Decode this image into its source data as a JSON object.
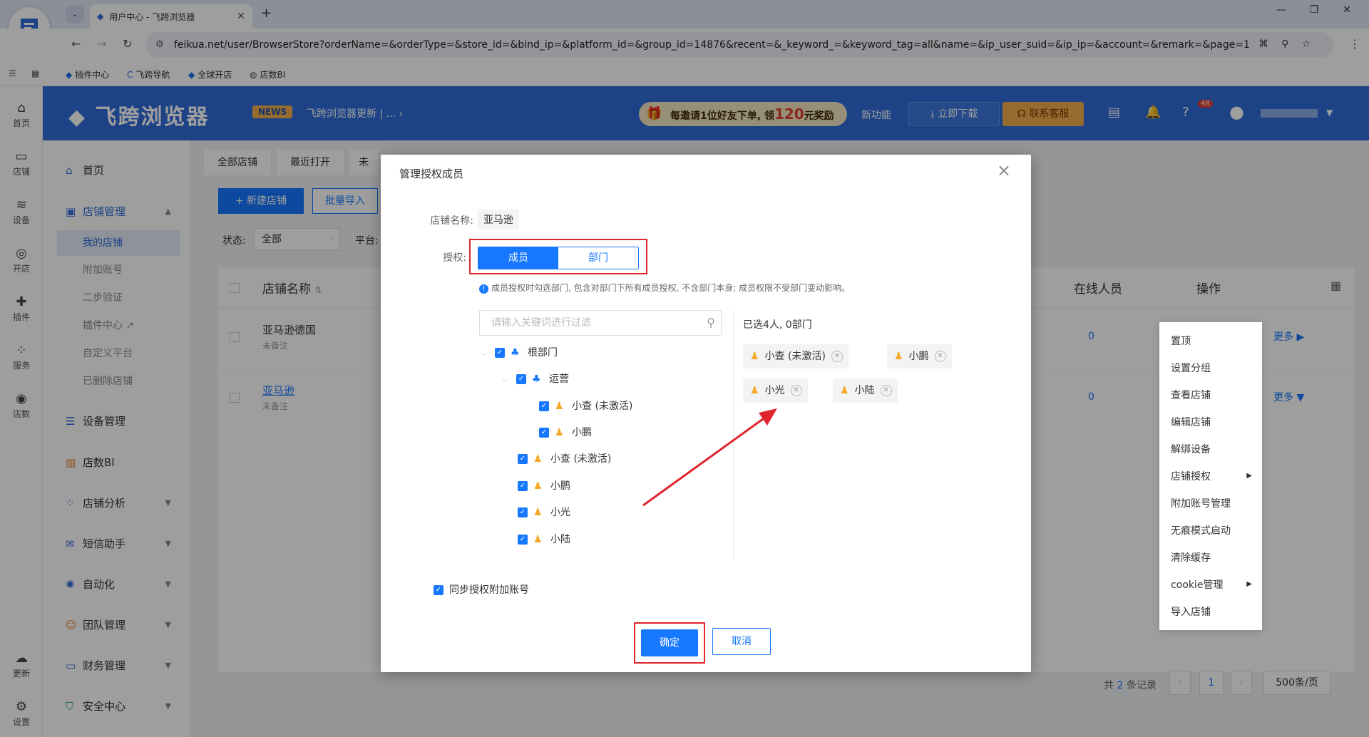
{
  "browser": {
    "tab_title": "用户中心 - 飞跨浏览器",
    "url": "feikua.net/user/BrowserStore?orderName=&orderType=&store_id=&bind_ip=&platform_id=&group_id=14876&recent=&_keyword_=&keyword_tag=all&name=&ip_user_suid=&ip_ip=&account=&remark=&page=1",
    "bookmarks": [
      "插件中心",
      "飞跨导航",
      "全球开店",
      "店数BI"
    ]
  },
  "rail": [
    "首页",
    "店铺",
    "设备",
    "开店",
    "插件",
    "服务",
    "店数",
    "更新",
    "设置"
  ],
  "header": {
    "logo": "飞跨浏览器",
    "news_badge": "NEWS",
    "news_text": "飞跨浏览器更新 | ...",
    "promo_pre": "每邀请1位好友下单, 领",
    "promo_amount": "120",
    "promo_post": "元奖励",
    "new_features": "新功能",
    "download": "立即下载",
    "contact": "联系客服",
    "bell_count": "48"
  },
  "sidebar": {
    "home": "首页",
    "store_mgmt": "店铺管理",
    "subs": [
      "我的店铺",
      "附加账号",
      "二步验证",
      "插件中心",
      "自定义平台",
      "已删除店铺"
    ],
    "items": [
      "设备管理",
      "店数BI",
      "店铺分析",
      "短信助手",
      "自动化",
      "团队管理",
      "财务管理",
      "安全中心"
    ]
  },
  "content": {
    "tabs": [
      "全部店铺",
      "最近打开",
      "未"
    ],
    "new_store": "新建店铺",
    "batch_import": "批量导入",
    "status_label": "状态:",
    "status_value": "全部",
    "platform_label": "平台:",
    "col_store": "店铺名称",
    "col_online": "在线人员",
    "col_action": "操作",
    "rows": [
      {
        "name": "亚马逊德国",
        "remark": "未备注",
        "online": "0",
        "more": "更多"
      },
      {
        "name": "亚马逊",
        "remark": "未备注",
        "online": "0",
        "more": "更多"
      }
    ],
    "pagination": {
      "total_pre": "共",
      "total": "2",
      "total_post": "条记录",
      "page": "1",
      "size": "500条/页"
    }
  },
  "context_menu": [
    "置顶",
    "设置分组",
    "查看店铺",
    "编辑店铺",
    "解绑设备",
    "店铺授权",
    "附加账号管理",
    "无痕模式启动",
    "清除缓存",
    "cookie管理",
    "导入店铺"
  ],
  "modal": {
    "title": "管理授权成员",
    "store_label": "店铺名称:",
    "store_value": "亚马逊",
    "auth_label": "授权:",
    "seg_member": "成员",
    "seg_dept": "部门",
    "hint": "成员授权时勾选部门, 包含对部门下所有成员授权, 不含部门本身; 成员权限不受部门变动影响。",
    "filter_placeholder": "请输入关键词进行过滤",
    "tree": {
      "root": "根部门",
      "dept": "运营",
      "dept_members": [
        "小查 (未激活)",
        "小鹏"
      ],
      "members": [
        "小查 (未激活)",
        "小鹏",
        "小光",
        "小陆"
      ]
    },
    "selected_count": "已选4人, 0部门",
    "chips": [
      "小查 (未激活)",
      "小鹏",
      "小光",
      "小陆"
    ],
    "sync_label": "同步授权附加账号",
    "confirm": "确定",
    "cancel": "取消"
  },
  "colors": {
    "primary": "#1677ff",
    "header": "#2f6cd9",
    "highlight": "#e0242c"
  }
}
